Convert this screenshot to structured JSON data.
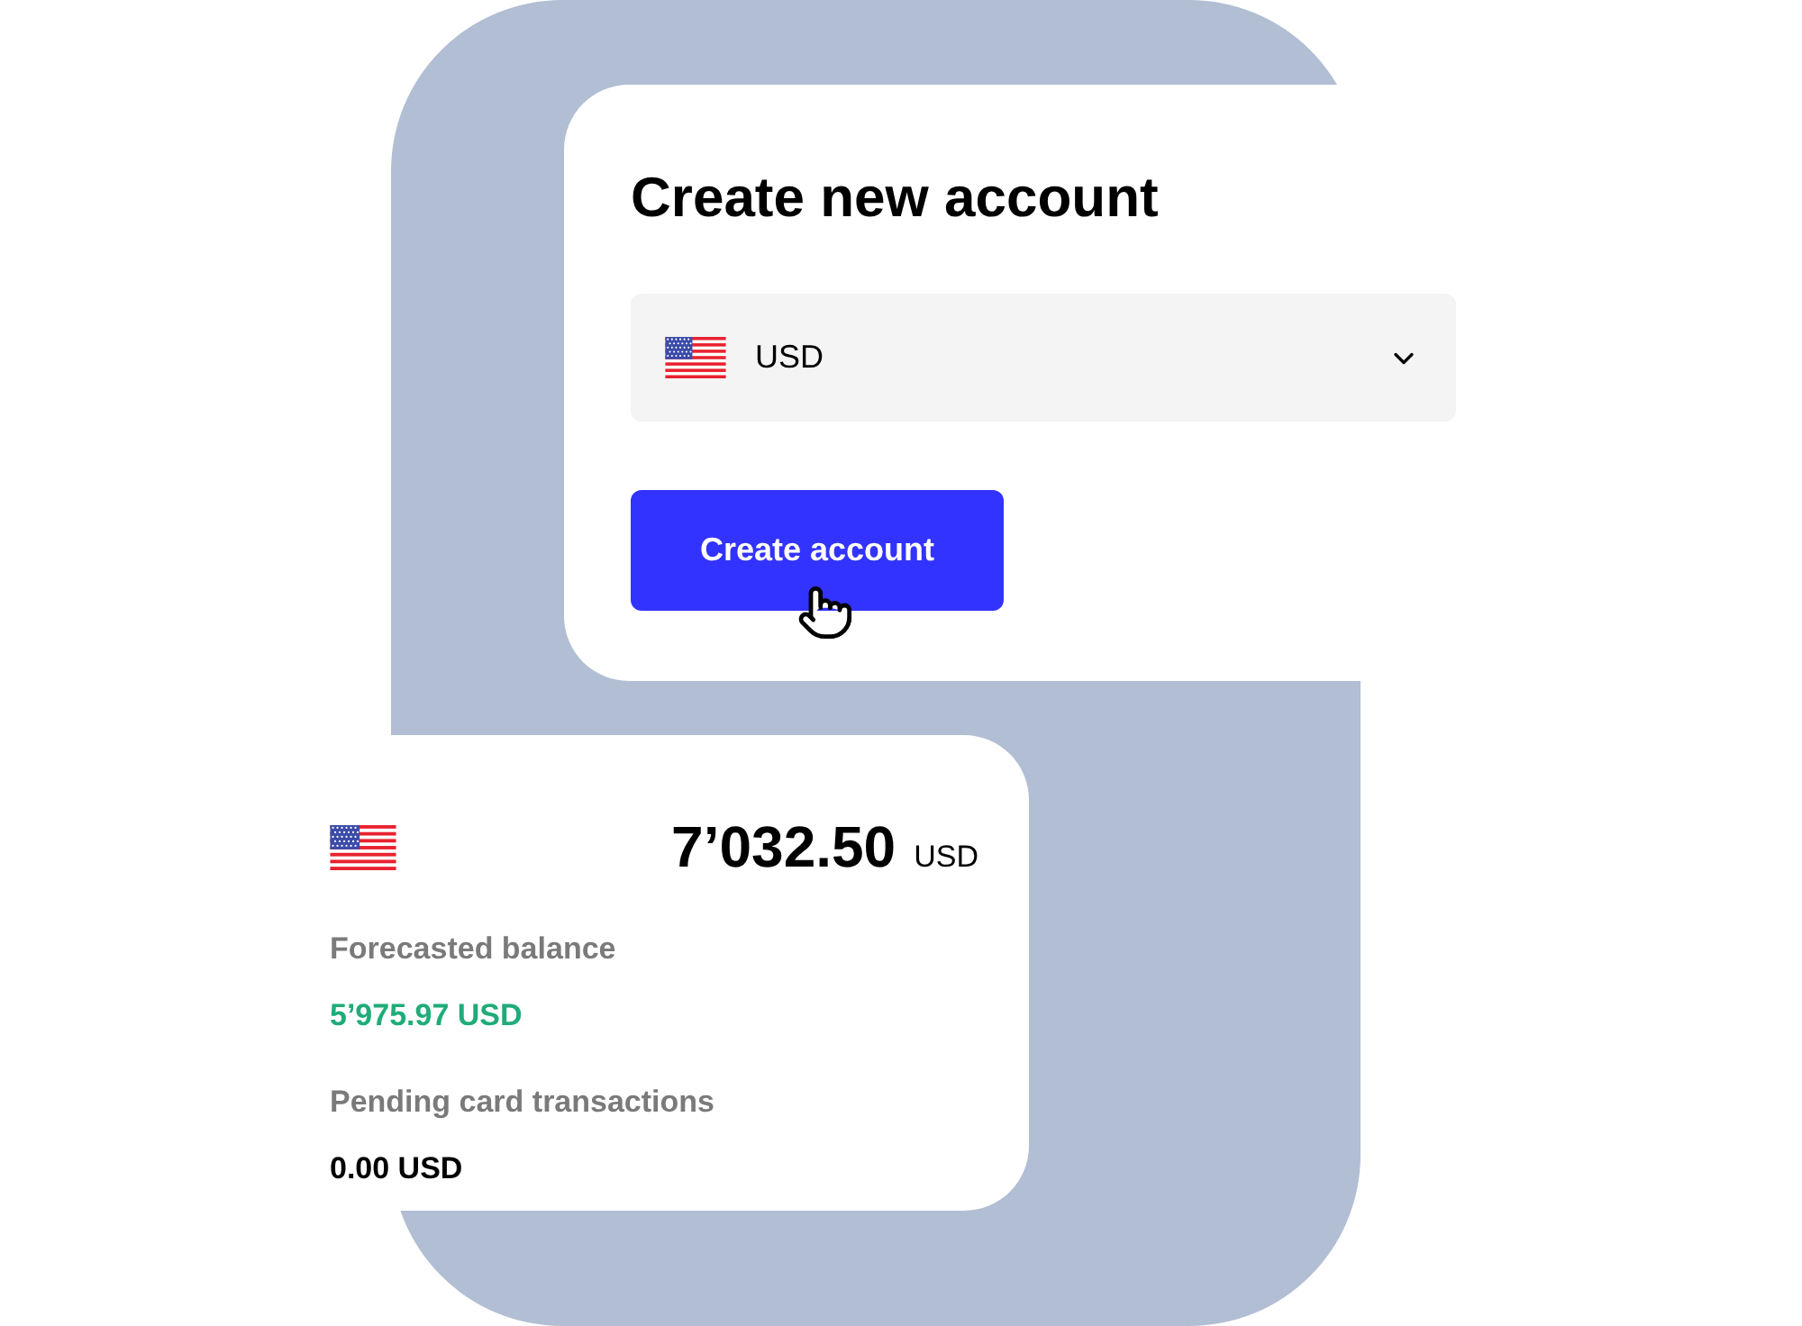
{
  "new_account": {
    "title": "Create new account",
    "currency_select": {
      "value": "USD"
    },
    "button": "Create account"
  },
  "balance_card": {
    "amount": "7’032.50",
    "currency": "USD",
    "forecast_label": "Forecasted balance",
    "forecast_value": "5’975.97 USD",
    "pending_label": "Pending card transactions",
    "pending_value": "0.00 USD"
  }
}
